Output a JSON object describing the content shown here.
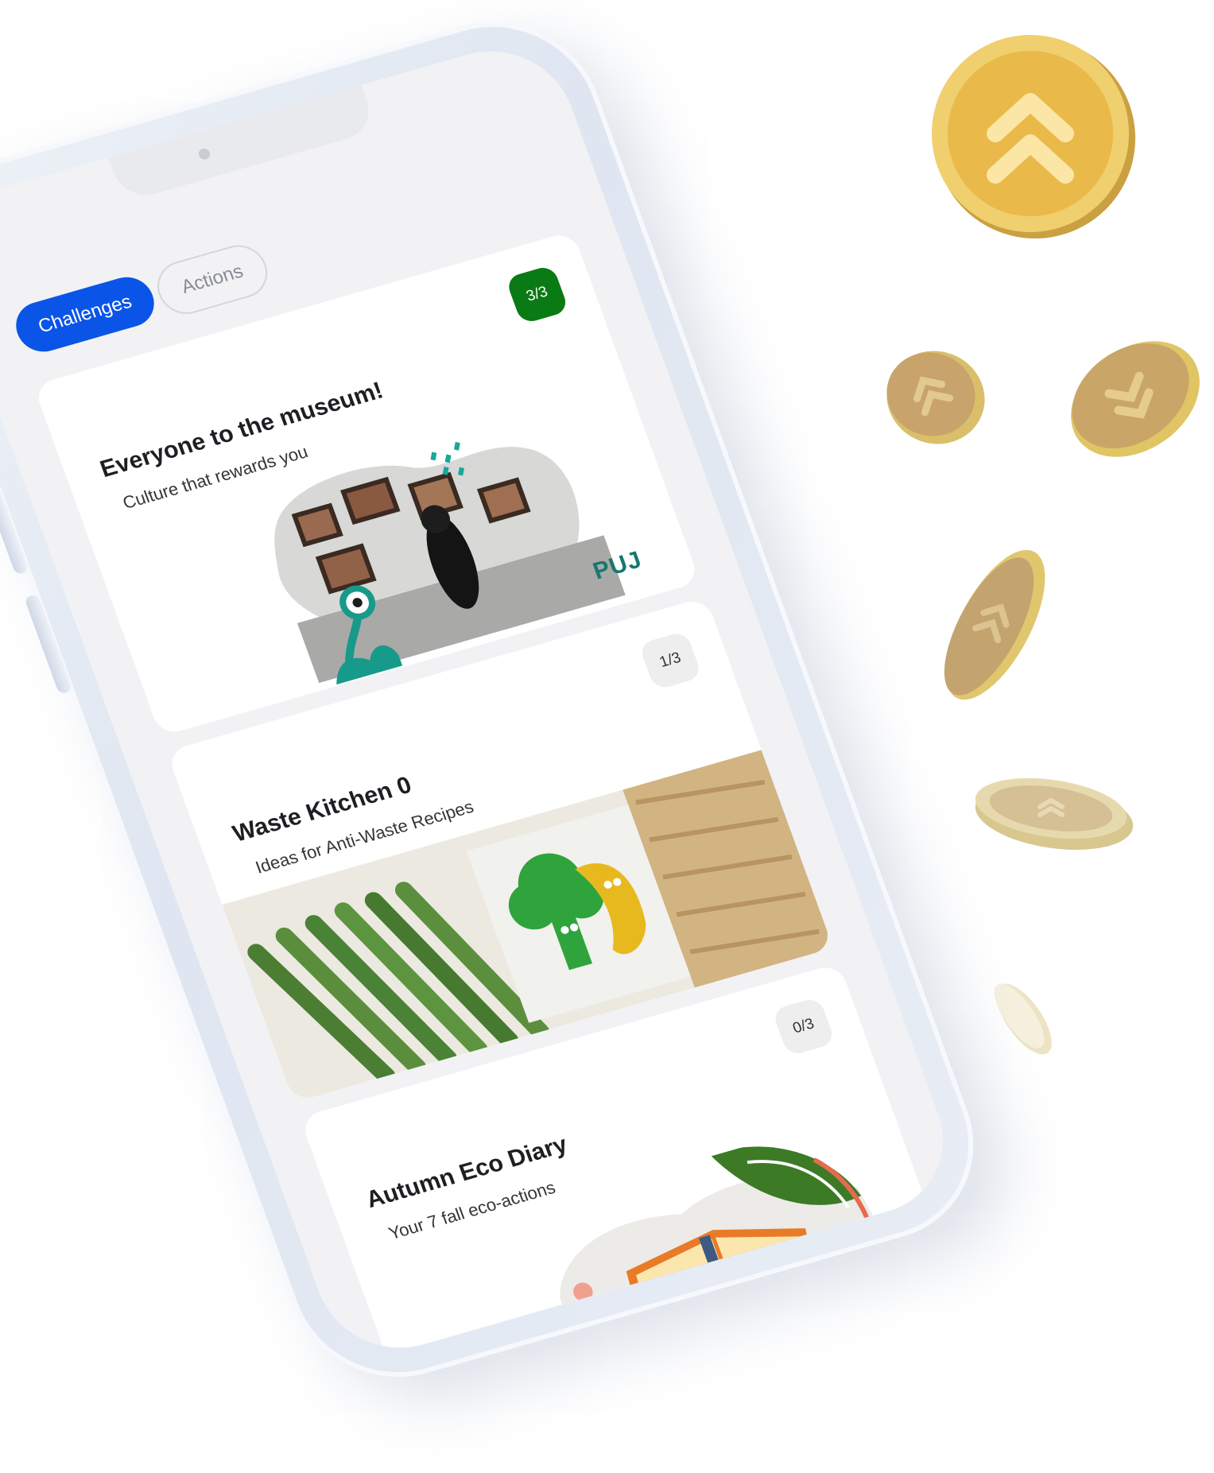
{
  "tabs": [
    {
      "label": "Challenges",
      "active": true
    },
    {
      "label": "Actions",
      "active": false
    }
  ],
  "challenges": [
    {
      "title": "Everyone to the museum!",
      "subtitle": "Culture that rewards you",
      "progress": "3/3",
      "completed": true,
      "logo_text": "PUJ"
    },
    {
      "title": "Waste Kitchen 0",
      "subtitle": "Ideas for Anti-Waste Recipes",
      "progress": "1/3",
      "completed": false
    },
    {
      "title": "Autumn Eco Diary",
      "subtitle": "Your 7 fall eco-actions",
      "progress": "0/3",
      "completed": false
    }
  ],
  "colors": {
    "accent": "#0a55e8",
    "completed_badge": "#0a7a14",
    "coin_gold": "#e9b94a"
  },
  "icons": [
    "coin-chevron-up-icon"
  ]
}
